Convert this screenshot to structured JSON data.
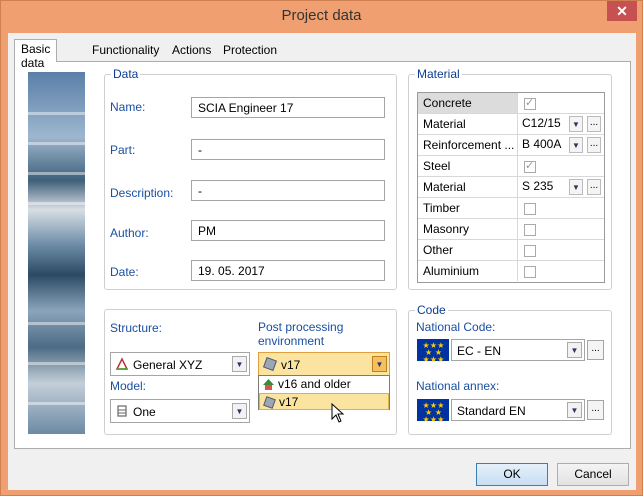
{
  "window": {
    "title": "Project data",
    "close_glyph": "✕"
  },
  "tabs": [
    {
      "label": "Basic data",
      "active": true
    },
    {
      "label": "Functionality",
      "active": false
    },
    {
      "label": "Actions",
      "active": false
    },
    {
      "label": "Protection",
      "active": false
    }
  ],
  "data_group": {
    "legend": "Data",
    "name_label": "Name:",
    "name_value": "SCIA Engineer 17",
    "part_label": "Part:",
    "part_value": "-",
    "description_label": "Description:",
    "description_value": "-",
    "author_label": "Author:",
    "author_value": "PM",
    "date_label": "Date:",
    "date_value": "19. 05. 2017"
  },
  "material_group": {
    "legend": "Material",
    "rows": [
      {
        "label": "Concrete",
        "type": "check",
        "checked": true,
        "selected": true
      },
      {
        "label": "Material",
        "type": "combo",
        "value": "C12/15"
      },
      {
        "label": "Reinforcement ...",
        "type": "combo",
        "value": "B 400A"
      },
      {
        "label": "Steel",
        "type": "check",
        "checked": true
      },
      {
        "label": "Material",
        "type": "combo",
        "value": "S 235"
      },
      {
        "label": "Timber",
        "type": "check",
        "checked": false
      },
      {
        "label": "Masonry",
        "type": "check",
        "checked": false
      },
      {
        "label": "Other",
        "type": "check",
        "checked": false
      },
      {
        "label": "Aluminium",
        "type": "check",
        "checked": false
      }
    ]
  },
  "structure_group": {
    "structure_label": "Structure:",
    "structure_value": "General XYZ",
    "post_label_line1": "Post processing",
    "post_label_line2": "environment",
    "post_value": "v17",
    "model_label": "Model:",
    "model_value": "One",
    "post_options": [
      "v16 and older",
      "v17"
    ]
  },
  "code_group": {
    "legend": "Code",
    "national_code_label": "National Code:",
    "national_code_value": "EC - EN",
    "national_annex_label": "National annex:",
    "national_annex_value": "Standard EN"
  },
  "buttons": {
    "ok": "OK",
    "cancel": "Cancel",
    "ellipsis": "..."
  },
  "colors": {
    "accent": "#1a4fa0",
    "title_bg": "#f0a070",
    "highlight": "#fbe3a0"
  }
}
